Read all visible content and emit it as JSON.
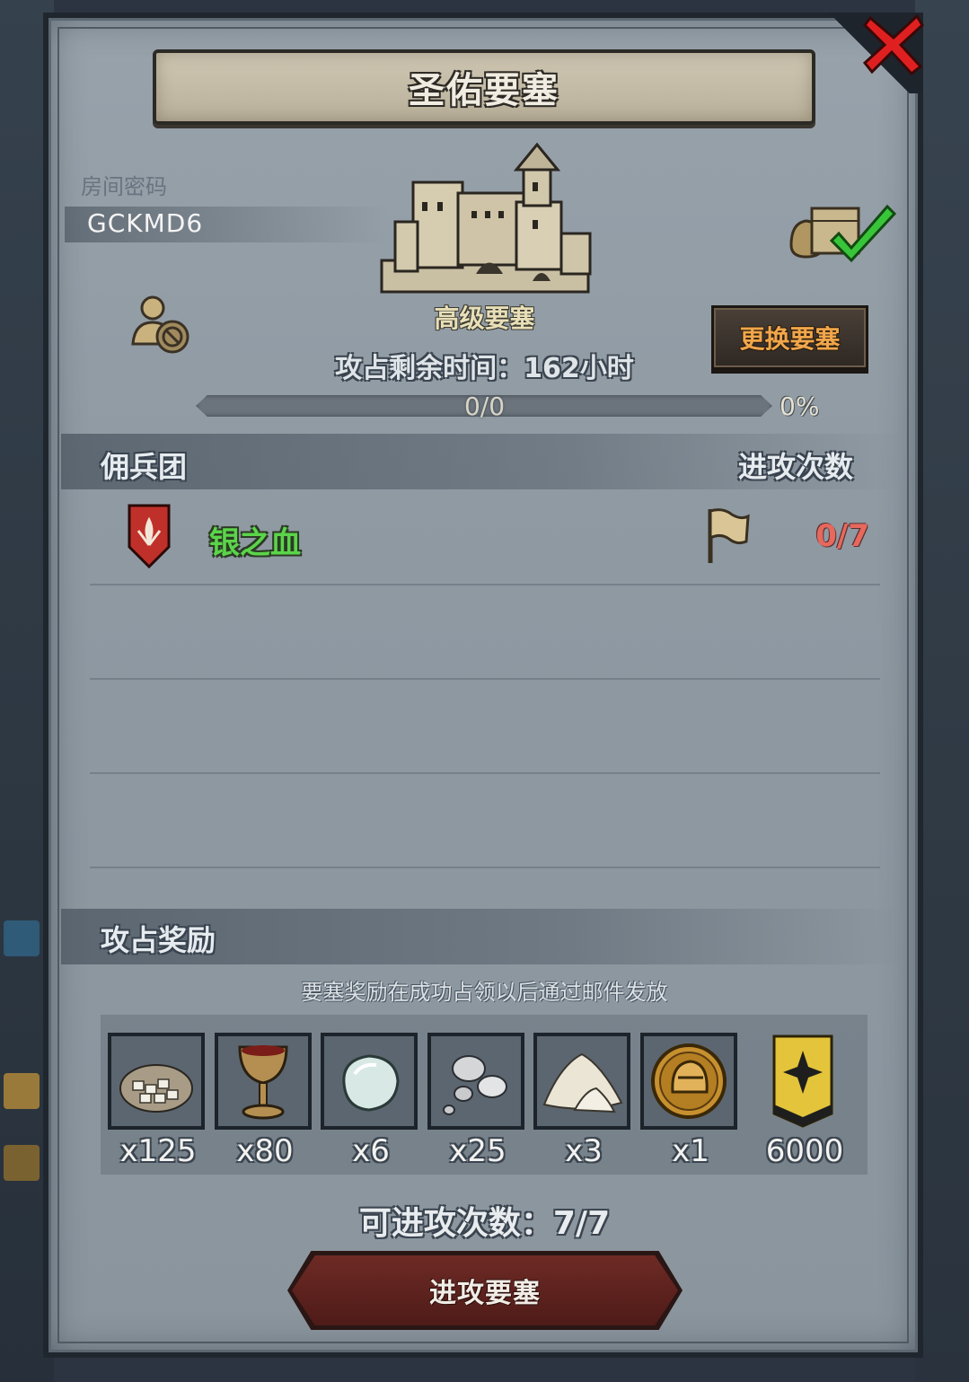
{
  "title": "圣佑要塞",
  "room": {
    "label": "房间密码",
    "code": "GCKMD6"
  },
  "fortress": {
    "level": "高级要塞",
    "change_button": "更换要塞",
    "time_remaining": "攻占剩余时间：162小时",
    "progress": {
      "count": "0/0",
      "percent": "0%",
      "fraction": 0
    }
  },
  "mercenary": {
    "section_title": "佣兵团",
    "attacks_header": "进攻次数",
    "rows": [
      {
        "name": "银之血",
        "attacks": "0/7"
      }
    ]
  },
  "rewards": {
    "section_title": "攻占奖励",
    "note": "要塞奖励在成功占领以后通过邮件发放",
    "items": [
      {
        "icon": "stone-sack-icon",
        "qty": "x125"
      },
      {
        "icon": "wine-goblet-icon",
        "qty": "x80"
      },
      {
        "icon": "gem-stone-icon",
        "qty": "x6"
      },
      {
        "icon": "silver-ore-icon",
        "qty": "x25"
      },
      {
        "icon": "flour-pile-icon",
        "qty": "x3"
      },
      {
        "icon": "knight-helmet-coin-icon",
        "qty": "x1"
      },
      {
        "icon": "gold-banner-icon",
        "qty": "6000"
      }
    ]
  },
  "attempts": "可进攻次数：7/7",
  "attack_button": "进攻要塞",
  "colors": {
    "merc_name": "#5bd44a",
    "attacks_red": "#e7685c",
    "change_btn_text": "#f0a64a",
    "close_red": "#e02020"
  }
}
